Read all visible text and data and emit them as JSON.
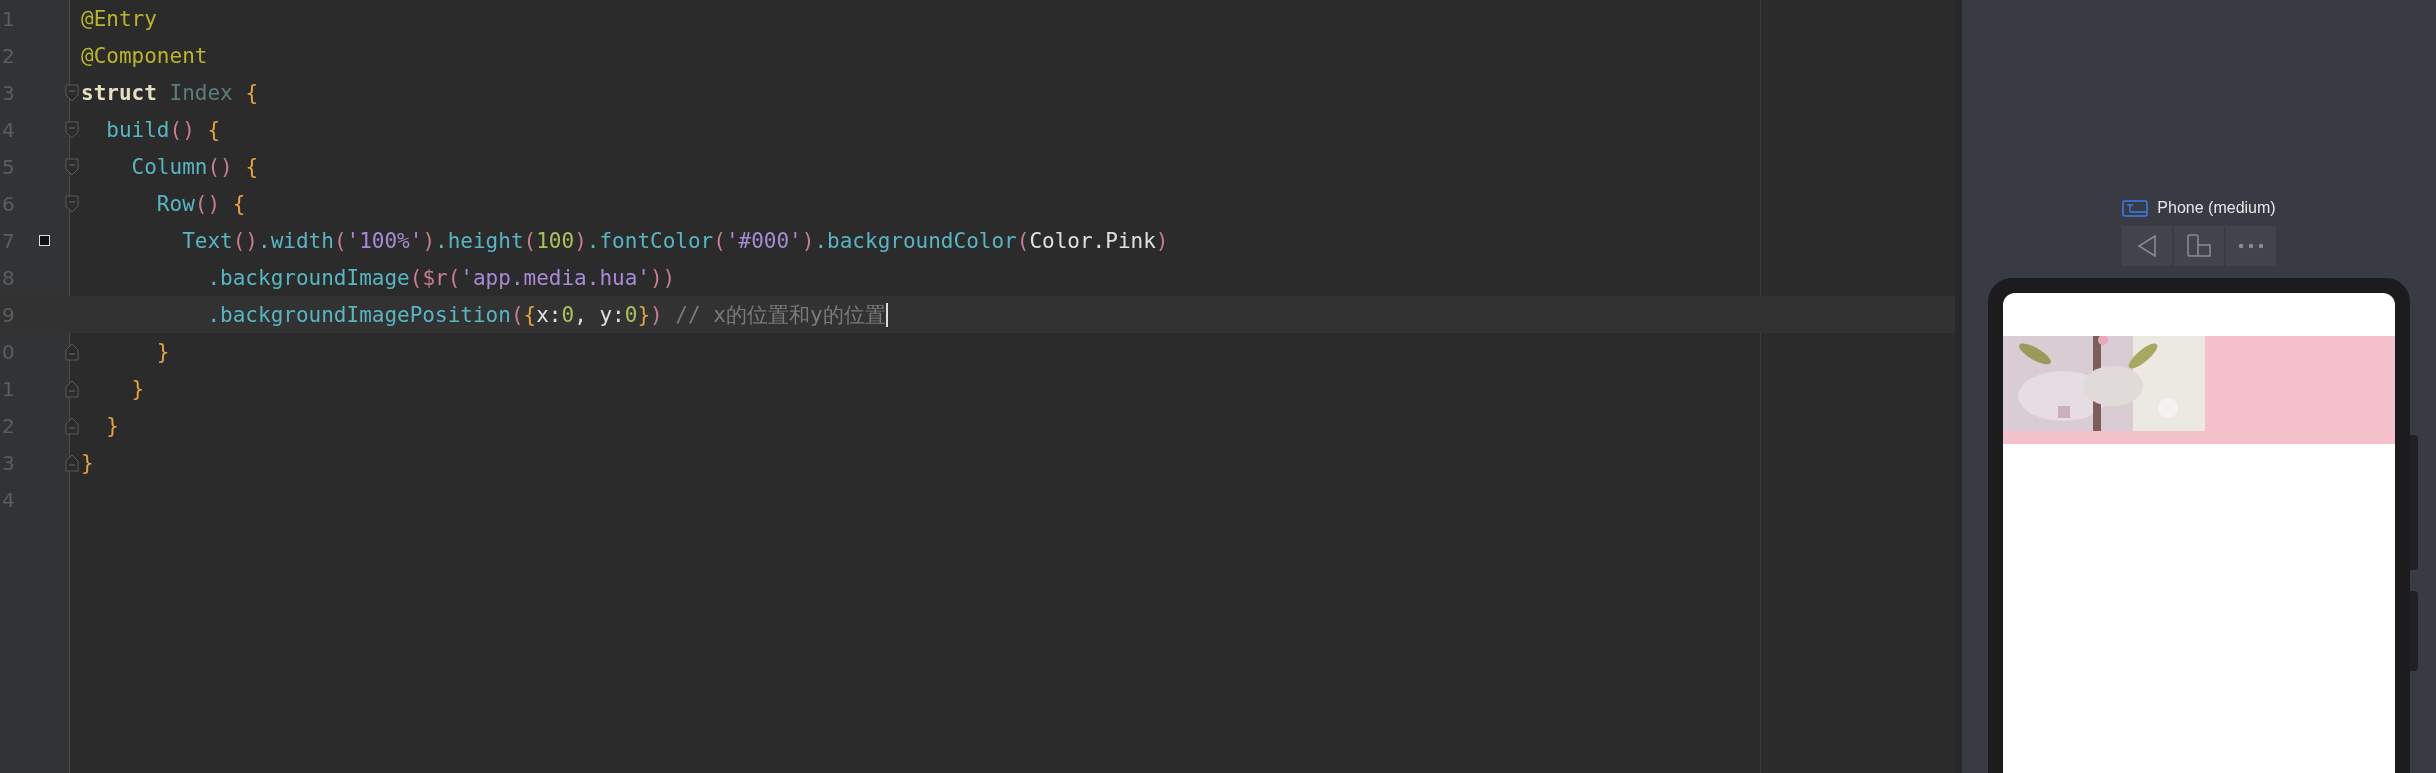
{
  "editor": {
    "lines": [
      {
        "number": "1",
        "fold_start": false,
        "fold_end": false,
        "bookmark": false,
        "current": false,
        "tokens": [
          {
            "text": "@Entry",
            "kind": "annotation"
          }
        ]
      },
      {
        "number": "2",
        "fold_start": false,
        "fold_end": false,
        "bookmark": false,
        "current": false,
        "tokens": [
          {
            "text": "@Component",
            "kind": "annotation"
          }
        ]
      },
      {
        "number": "3",
        "fold_start": true,
        "fold_end": false,
        "bookmark": false,
        "current": false,
        "tokens": [
          {
            "text": "struct",
            "kind": "keyword"
          },
          {
            "text": " Index ",
            "kind": "type"
          },
          {
            "text": "{",
            "kind": "brace"
          }
        ]
      },
      {
        "number": "4",
        "fold_start": true,
        "fold_end": false,
        "bookmark": false,
        "current": false,
        "tokens": [
          {
            "text": "  build",
            "kind": "func"
          },
          {
            "text": "()",
            "kind": "paren"
          },
          {
            "text": " {",
            "kind": "brace"
          }
        ]
      },
      {
        "number": "5",
        "fold_start": true,
        "fold_end": false,
        "bookmark": false,
        "current": false,
        "tokens": [
          {
            "text": "    Column",
            "kind": "func"
          },
          {
            "text": "()",
            "kind": "paren"
          },
          {
            "text": " {",
            "kind": "brace"
          }
        ]
      },
      {
        "number": "6",
        "fold_start": true,
        "fold_end": false,
        "bookmark": false,
        "current": false,
        "tokens": [
          {
            "text": "      Row",
            "kind": "func"
          },
          {
            "text": "()",
            "kind": "paren"
          },
          {
            "text": " {",
            "kind": "brace"
          }
        ]
      },
      {
        "number": "7",
        "fold_start": false,
        "fold_end": false,
        "bookmark": true,
        "current": false,
        "tokens": [
          {
            "text": "        Text",
            "kind": "func"
          },
          {
            "text": "()",
            "kind": "paren"
          },
          {
            "text": ".width",
            "kind": "func"
          },
          {
            "text": "(",
            "kind": "paren"
          },
          {
            "text": "'100%'",
            "kind": "string"
          },
          {
            "text": ")",
            "kind": "paren"
          },
          {
            "text": ".height",
            "kind": "func"
          },
          {
            "text": "(",
            "kind": "paren"
          },
          {
            "text": "100",
            "kind": "number"
          },
          {
            "text": ")",
            "kind": "paren"
          },
          {
            "text": ".fontColor",
            "kind": "func"
          },
          {
            "text": "(",
            "kind": "paren"
          },
          {
            "text": "'#000'",
            "kind": "string"
          },
          {
            "text": ")",
            "kind": "paren"
          },
          {
            "text": ".backgroundColor",
            "kind": "func"
          },
          {
            "text": "(",
            "kind": "paren"
          },
          {
            "text": "Color.Pink",
            "kind": "plain"
          },
          {
            "text": ")",
            "kind": "paren"
          }
        ]
      },
      {
        "number": "8",
        "fold_start": false,
        "fold_end": false,
        "bookmark": false,
        "current": false,
        "tokens": [
          {
            "text": "          .backgroundImage",
            "kind": "func"
          },
          {
            "text": "($r(",
            "kind": "paren"
          },
          {
            "text": "'app.media.hua'",
            "kind": "string"
          },
          {
            "text": "))",
            "kind": "paren"
          }
        ]
      },
      {
        "number": "9",
        "fold_start": false,
        "fold_end": false,
        "bookmark": false,
        "current": true,
        "tokens": [
          {
            "text": "          .backgroundImagePosition",
            "kind": "func"
          },
          {
            "text": "(",
            "kind": "paren"
          },
          {
            "text": "{",
            "kind": "brace"
          },
          {
            "text": "x:",
            "kind": "plain"
          },
          {
            "text": "0",
            "kind": "number"
          },
          {
            "text": ", y:",
            "kind": "plain"
          },
          {
            "text": "0",
            "kind": "number"
          },
          {
            "text": "}",
            "kind": "brace"
          },
          {
            "text": ")",
            "kind": "paren"
          },
          {
            "text": " // x的位置和y的位置",
            "kind": "comment"
          }
        ]
      },
      {
        "number": "0",
        "fold_start": false,
        "fold_end": true,
        "bookmark": false,
        "current": false,
        "tokens": [
          {
            "text": "      }",
            "kind": "brace"
          }
        ]
      },
      {
        "number": "1",
        "fold_start": false,
        "fold_end": true,
        "bookmark": false,
        "current": false,
        "tokens": [
          {
            "text": "    }",
            "kind": "brace"
          }
        ]
      },
      {
        "number": "2",
        "fold_start": false,
        "fold_end": true,
        "bookmark": false,
        "current": false,
        "tokens": [
          {
            "text": "  }",
            "kind": "brace"
          }
        ]
      },
      {
        "number": "3",
        "fold_start": false,
        "fold_end": true,
        "bookmark": false,
        "current": false,
        "tokens": [
          {
            "text": "}",
            "kind": "brace"
          }
        ]
      },
      {
        "number": "4",
        "fold_start": false,
        "fold_end": false,
        "bookmark": false,
        "current": false
      }
    ]
  },
  "previewer": {
    "device": "Phone (medium)"
  }
}
